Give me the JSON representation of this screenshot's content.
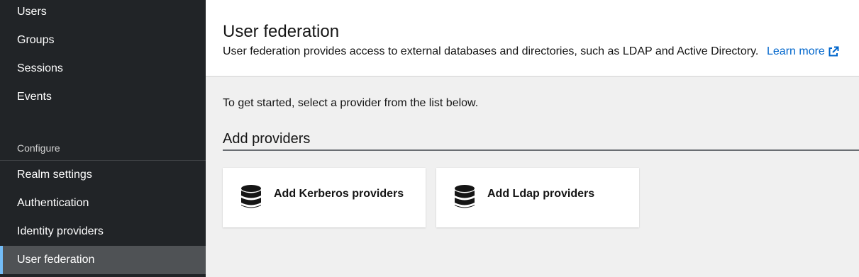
{
  "sidebar": {
    "items_top": [
      {
        "label": "Users"
      },
      {
        "label": "Groups"
      },
      {
        "label": "Sessions"
      },
      {
        "label": "Events"
      }
    ],
    "section_label": "Configure",
    "items_configure": [
      {
        "label": "Realm settings"
      },
      {
        "label": "Authentication"
      },
      {
        "label": "Identity providers"
      },
      {
        "label": "User federation",
        "active": true
      }
    ]
  },
  "header": {
    "title": "User federation",
    "description": "User federation provides access to external databases and directories, such as LDAP and Active Directory.",
    "learn_more": "Learn more",
    "learn_more_icon": "external-link-icon"
  },
  "main": {
    "intro": "To get started, select a provider from the list below.",
    "section_title": "Add providers",
    "providers": [
      {
        "label": "Add Kerberos providers",
        "icon": "database-icon"
      },
      {
        "label": "Add Ldap providers",
        "icon": "database-icon"
      }
    ]
  },
  "colors": {
    "sidebar_bg": "#212427",
    "sidebar_active_bg": "#4f5255",
    "active_indicator": "#73bcf7",
    "link": "#0066cc",
    "content_bg": "#f0f0f0"
  }
}
